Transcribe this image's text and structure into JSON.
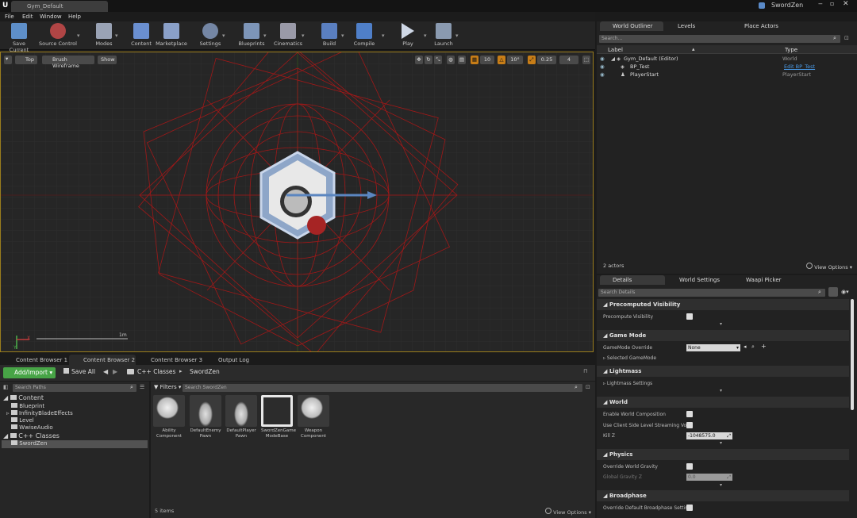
{
  "window": {
    "tab": "Gym_Default",
    "project": "SwordZen"
  },
  "menu": [
    "File",
    "Edit",
    "Window",
    "Help"
  ],
  "toolbar": [
    {
      "label": "Save Current",
      "icon": "save-icon"
    },
    {
      "label": "Source Control",
      "icon": "source-control-icon"
    },
    {
      "label": "Modes",
      "icon": "modes-icon"
    },
    {
      "label": "Content",
      "icon": "content-icon"
    },
    {
      "label": "Marketplace",
      "icon": "marketplace-icon"
    },
    {
      "label": "Settings",
      "icon": "settings-icon"
    },
    {
      "label": "Blueprints",
      "icon": "blueprints-icon"
    },
    {
      "label": "Cinematics",
      "icon": "cinematics-icon"
    },
    {
      "label": "Build",
      "icon": "build-icon"
    },
    {
      "label": "Compile",
      "icon": "compile-icon"
    },
    {
      "label": "Play",
      "icon": "play-icon"
    },
    {
      "label": "Launch",
      "icon": "launch-icon"
    }
  ],
  "viewport": {
    "view_mode": "Top",
    "render_mode": "Brush Wireframe",
    "show": "Show",
    "grid_snap": "10",
    "rot_snap": "10°",
    "scale_snap": "0.25",
    "camera_speed": "4",
    "scale_label": "1m",
    "axis_x": "X",
    "axis_y": "Y",
    "colors": {
      "grid": "#363636",
      "wire": "#b01818",
      "border": "#9a7d1c"
    }
  },
  "content_tabs": [
    "Content Browser 1",
    "Content Browser 2",
    "Content Browser 3",
    "Output Log"
  ],
  "content_toolbar": {
    "add_import": "Add/Import",
    "save_all": "Save All",
    "breadcrumb": [
      "C++ Classes",
      "SwordZen"
    ]
  },
  "paths": {
    "search_placeholder": "Search Paths",
    "tree": [
      {
        "label": "Content",
        "level": 0,
        "expanded": true
      },
      {
        "label": "Blueprint",
        "level": 1
      },
      {
        "label": "InfinityBladeEffects",
        "level": 1,
        "has_children": true
      },
      {
        "label": "Level",
        "level": 1
      },
      {
        "label": "WwiseAudio",
        "level": 1
      },
      {
        "label": "C++ Classes",
        "level": 0,
        "expanded": true
      },
      {
        "label": "SwordZen",
        "level": 1,
        "selected": true
      }
    ]
  },
  "assets": {
    "filters": "Filters",
    "search_placeholder": "Search SwordZen",
    "items": [
      "Ability Component",
      "DefaultEnemy Pawn",
      "DefaultPlayer Pawn",
      "SwordZenGame ModeBase",
      "Weapon Component"
    ],
    "count": "5 items",
    "view_options": "View Options"
  },
  "outliner": {
    "tabs": [
      "World Outliner",
      "Levels",
      "Place Actors"
    ],
    "search_placeholder": "Search...",
    "columns": [
      "Label",
      "Type"
    ],
    "rows": [
      {
        "label": "Gym_Default (Editor)",
        "type": "World",
        "indent": 0
      },
      {
        "label": "BP_Test",
        "type": "Edit BP_Test",
        "indent": 1,
        "link": true
      },
      {
        "label": "PlayerStart",
        "type": "PlayerStart",
        "indent": 1
      }
    ],
    "count": "2 actors",
    "view_options": "View Options"
  },
  "details": {
    "tabs": [
      "Details",
      "World Settings",
      "Waapi Picker"
    ],
    "search_placeholder": "Search Details",
    "sections": [
      {
        "title": "Precomputed Visibility",
        "props": [
          {
            "label": "Precompute Visibility",
            "type": "checkbox"
          }
        ]
      },
      {
        "title": "Game Mode",
        "props": [
          {
            "label": "GameMode Override",
            "type": "select",
            "value": "None"
          },
          {
            "label": "Selected GameMode",
            "type": "expander"
          }
        ]
      },
      {
        "title": "Lightmass",
        "props": [
          {
            "label": "Lightmass Settings",
            "type": "expander"
          }
        ]
      },
      {
        "title": "World",
        "props": [
          {
            "label": "Enable World Composition",
            "type": "checkbox"
          },
          {
            "label": "Use Client Side Level Streaming Vol",
            "type": "checkbox"
          },
          {
            "label": "Kill Z",
            "type": "number",
            "value": "-1048575.0"
          }
        ]
      },
      {
        "title": "Physics",
        "props": [
          {
            "label": "Override World Gravity",
            "type": "checkbox"
          },
          {
            "label": "Global Gravity Z",
            "type": "number",
            "value": "0.0",
            "disabled": true
          }
        ]
      },
      {
        "title": "Broadphase",
        "props": [
          {
            "label": "Override Default Broadphase Setting",
            "type": "checkbox"
          }
        ]
      }
    ]
  }
}
